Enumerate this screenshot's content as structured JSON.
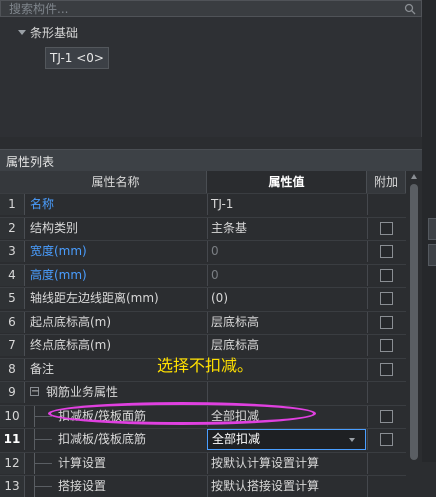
{
  "search": {
    "placeholder": "搜索构件..."
  },
  "tree": {
    "category": "条形基础",
    "node": "TJ-1 <0>"
  },
  "panel": {
    "title": "属性列表"
  },
  "grid": {
    "headers": {
      "name": "属性名称",
      "value": "属性值",
      "add": "附加"
    },
    "rows": [
      {
        "num": "1",
        "name": "名称",
        "value": "TJ-1",
        "blue": true,
        "dim": false,
        "checkbox": false
      },
      {
        "num": "2",
        "name": "结构类别",
        "value": "主条基",
        "blue": false,
        "dim": false,
        "checkbox": true
      },
      {
        "num": "3",
        "name": "宽度(mm)",
        "value": "0",
        "blue": true,
        "dim": true,
        "checkbox": true
      },
      {
        "num": "4",
        "name": "高度(mm)",
        "value": "0",
        "blue": true,
        "dim": true,
        "checkbox": true
      },
      {
        "num": "5",
        "name": "轴线距左边线距离(mm)",
        "value": "(0)",
        "blue": false,
        "dim": false,
        "checkbox": true
      },
      {
        "num": "6",
        "name": "起点底标高(m)",
        "value": "层底标高",
        "blue": false,
        "dim": false,
        "checkbox": true
      },
      {
        "num": "7",
        "name": "终点底标高(m)",
        "value": "层底标高",
        "blue": false,
        "dim": false,
        "checkbox": true
      },
      {
        "num": "8",
        "name": "备注",
        "value": "",
        "blue": false,
        "dim": false,
        "checkbox": true
      },
      {
        "num": "9",
        "name": "钢筋业务属性",
        "value": "",
        "blue": false,
        "dim": false,
        "checkbox": false,
        "group": true
      },
      {
        "num": "10",
        "name": "扣减板/筏板面筋",
        "value": "全部扣减",
        "blue": false,
        "dim": false,
        "checkbox": true
      },
      {
        "num": "11",
        "name": "扣减板/筏板底筋",
        "value": "全部扣减",
        "blue": false,
        "dim": false,
        "checkbox": true,
        "selected": true
      },
      {
        "num": "12",
        "name": "计算设置",
        "value": "按默认计算设置计算",
        "blue": false,
        "dim": false,
        "checkbox": false
      },
      {
        "num": "13",
        "name": "搭接设置",
        "value": "按默认搭接设置计算",
        "blue": false,
        "dim": false,
        "checkbox": false
      }
    ]
  },
  "annotation": {
    "text": "选择不扣减。"
  },
  "colors": {
    "accent": "#4a9eff",
    "annotation": "#ffe000",
    "highlight": "#e040e0"
  }
}
